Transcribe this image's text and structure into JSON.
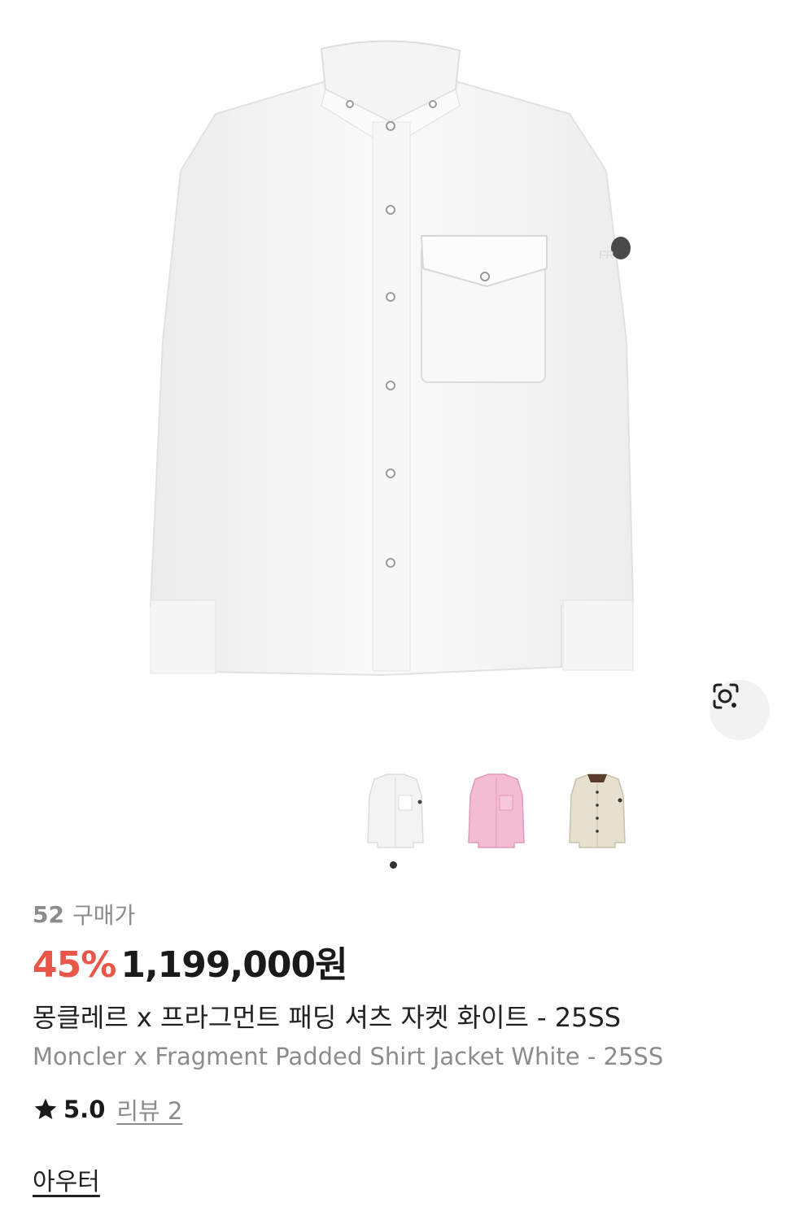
{
  "product": {
    "purchase_count": "52",
    "purchase_label": "구매가",
    "discount": "45%",
    "price": "1,199,000원",
    "name_ko": "몽클레르 x 프라그먼트 패딩 셔츠 자켓 화이트 - 25SS",
    "name_en": "Moncler x Fragment Padded Shirt Jacket White - 25SS",
    "rating": "5.0",
    "review_label": "리뷰 2",
    "category": "아우터"
  },
  "gallery": {
    "thumbnails": [
      {
        "color": "#f3f3f3",
        "name": "white"
      },
      {
        "color": "#f4bcd3",
        "name": "pink"
      },
      {
        "color": "#e6e0d0",
        "name": "beige"
      }
    ],
    "active_index": 0
  },
  "colors": {
    "discount": "#e8574a",
    "muted": "#8c8c8c",
    "text": "#222222"
  },
  "icons": {
    "lens": "lens-search-icon",
    "star": "star-icon"
  }
}
